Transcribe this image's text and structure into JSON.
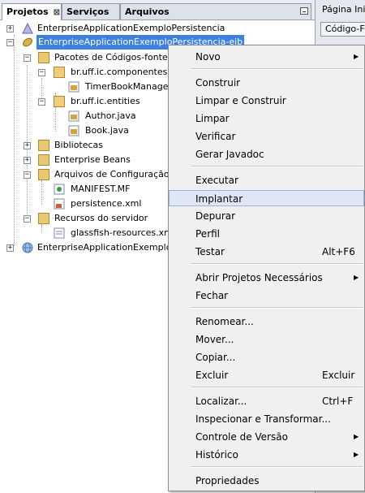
{
  "panel": {
    "tabs": [
      {
        "label": "Projetos",
        "close": "⊠"
      },
      {
        "label": "Serviços"
      },
      {
        "label": "Arquivos"
      }
    ]
  },
  "tree": {
    "items": [
      {
        "label": "EnterpriseApplicationExemploPersistencia"
      },
      {
        "label": "EnterpriseApplicationExemploPersistencia-ejb"
      },
      {
        "label": "Pacotes de Códigos-fonte"
      },
      {
        "label": "br.uff.ic.componentes"
      },
      {
        "label": "TimerBookManager.ja"
      },
      {
        "label": "br.uff.ic.entities"
      },
      {
        "label": "Author.java"
      },
      {
        "label": "Book.java"
      },
      {
        "label": "Bibliotecas"
      },
      {
        "label": "Enterprise Beans"
      },
      {
        "label": "Arquivos de Configuração"
      },
      {
        "label": "MANIFEST.MF"
      },
      {
        "label": "persistence.xml"
      },
      {
        "label": "Recursos do servidor"
      },
      {
        "label": "glassfish-resources.xml"
      },
      {
        "label": "EnterpriseApplicationExemploPer"
      }
    ]
  },
  "editor_tabs": {
    "tab1": "Página Inic",
    "tab2": "Código-Fo"
  },
  "menu": {
    "items": [
      {
        "label": "Novo",
        "submenu": "▶"
      },
      {
        "label": "Construir"
      },
      {
        "label": "Limpar e Construir"
      },
      {
        "label": "Limpar"
      },
      {
        "label": "Verificar"
      },
      {
        "label": "Gerar Javadoc"
      },
      {
        "label": "Executar"
      },
      {
        "label": "Implantar"
      },
      {
        "label": "Depurar"
      },
      {
        "label": "Perfil"
      },
      {
        "label": "Testar",
        "shortcut": "Alt+F6"
      },
      {
        "label": "Abrir Projetos Necessários",
        "submenu": "▶"
      },
      {
        "label": "Fechar"
      },
      {
        "label": "Renomear..."
      },
      {
        "label": "Mover..."
      },
      {
        "label": "Copiar..."
      },
      {
        "label": "Excluir",
        "shortcut": "Excluir"
      },
      {
        "label": "Localizar...",
        "shortcut": "Ctrl+F"
      },
      {
        "label": "Inspecionar e Transformar..."
      },
      {
        "label": "Controle de Versão",
        "submenu": "▶"
      },
      {
        "label": "Histórico",
        "submenu": "▶"
      },
      {
        "label": "Propriedades"
      }
    ]
  }
}
